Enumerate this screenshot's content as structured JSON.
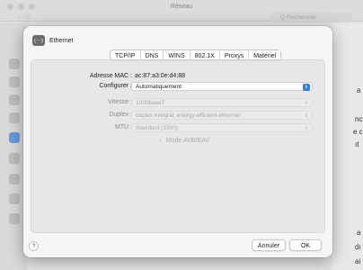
{
  "background_window": {
    "title": "Réseau",
    "search_placeholder": "Q  Rechercher",
    "nav_arrows": "‹  ›  ⠿",
    "right_snippets": [
      "a",
      "nc",
      "e c",
      "ıt",
      "a",
      "dı",
      "ai"
    ]
  },
  "sheet": {
    "title": "Ethernet",
    "icon_glyph": "⟨···⟩",
    "tabs": [
      "TCP/IP",
      "DNS",
      "WINS",
      "802.1X",
      "Proxys",
      "Matériel"
    ],
    "active_tab": "Matériel",
    "mac": {
      "label": "Adresse MAC :",
      "value": "ac:87:a3:0e:d4:88"
    },
    "configure": {
      "label": "Configurer :",
      "value": "Automatiquement"
    },
    "speed": {
      "label": "Vitesse :",
      "value": "1000baseT"
    },
    "duplex": {
      "label": "Duplex :",
      "value": "duplex intégral, energy-efficient-ethernet"
    },
    "mtu": {
      "label": "MTU :",
      "value": "Standard  (1500)"
    },
    "avb": {
      "label": "Mode AVB/EAV",
      "checked": true
    },
    "help_label": "?",
    "cancel_label": "Annuler",
    "ok_label": "OK"
  }
}
